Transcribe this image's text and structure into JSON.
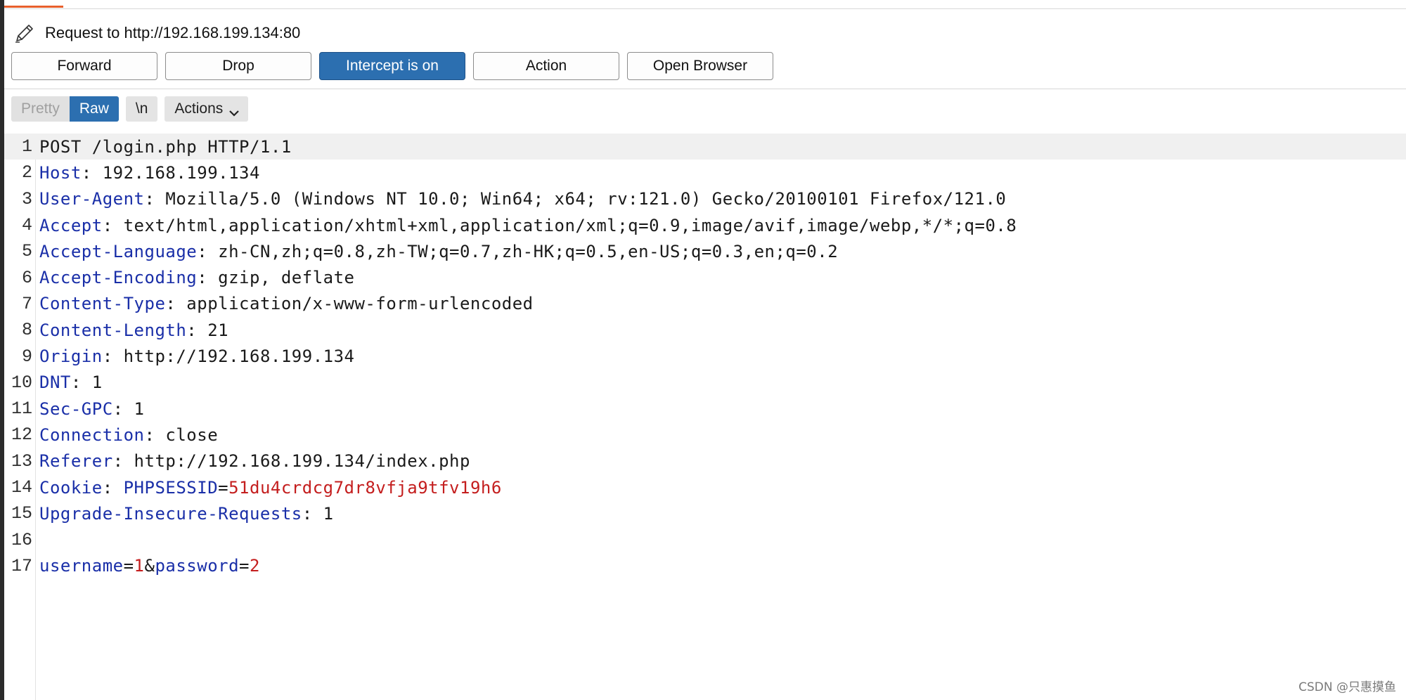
{
  "request": {
    "title": "Request to http://192.168.199.134:80"
  },
  "toolbar": {
    "forward": "Forward",
    "drop": "Drop",
    "intercept": "Intercept is on",
    "action": "Action",
    "open_browser": "Open Browser"
  },
  "view_tabs": {
    "pretty": "Pretty",
    "raw": "Raw",
    "selected": "Raw",
    "newline": "\\n",
    "actions": "Actions"
  },
  "lines": [
    {
      "num": "1",
      "text": "POST /login.php HTTP/1.1"
    },
    {
      "num": "2",
      "key": "Host",
      "value": " 192.168.199.134"
    },
    {
      "num": "3",
      "key": "User-Agent",
      "value": " Mozilla/5.0 (Windows NT 10.0; Win64; x64; rv:121.0) Gecko/20100101 Firefox/121.0"
    },
    {
      "num": "4",
      "key": "Accept",
      "value": " text/html,application/xhtml+xml,application/xml;q=0.9,image/avif,image/webp,*/*;q=0.8"
    },
    {
      "num": "5",
      "key": "Accept-Language",
      "value": " zh-CN,zh;q=0.8,zh-TW;q=0.7,zh-HK;q=0.5,en-US;q=0.3,en;q=0.2"
    },
    {
      "num": "6",
      "key": "Accept-Encoding",
      "value": " gzip, deflate"
    },
    {
      "num": "7",
      "key": "Content-Type",
      "value": " application/x-www-form-urlencoded"
    },
    {
      "num": "8",
      "key": "Content-Length",
      "value": " 21"
    },
    {
      "num": "9",
      "key": "Origin",
      "value": " http://192.168.199.134"
    },
    {
      "num": "10",
      "key": "DNT",
      "value": " 1"
    },
    {
      "num": "11",
      "key": "Sec-GPC",
      "value": " 1"
    },
    {
      "num": "12",
      "key": "Connection",
      "value": " close"
    },
    {
      "num": "13",
      "key": "Referer",
      "value": " http://192.168.199.134/index.php"
    },
    {
      "num": "14",
      "key": "Cookie",
      "cookie_name": "PHPSESSID",
      "cookie_value": "51du4crdcg7dr8vfja9tfv19h6"
    },
    {
      "num": "15",
      "key": "Upgrade-Insecure-Requests",
      "value": " 1"
    },
    {
      "num": "16",
      "text": ""
    },
    {
      "num": "17",
      "params": [
        {
          "name": "username",
          "value": "1"
        },
        {
          "name": "password",
          "value": "2"
        }
      ]
    }
  ],
  "colors": {
    "accent": "#2c6fb0",
    "header_key": "#1a2fa8",
    "param_value": "#c41e1e",
    "top_tab": "#e8602c"
  },
  "icons": {
    "request_icon": "pencil-icon",
    "actions_dropdown": "chevron-down-icon"
  },
  "watermark": "CSDN @只惠摸鱼"
}
